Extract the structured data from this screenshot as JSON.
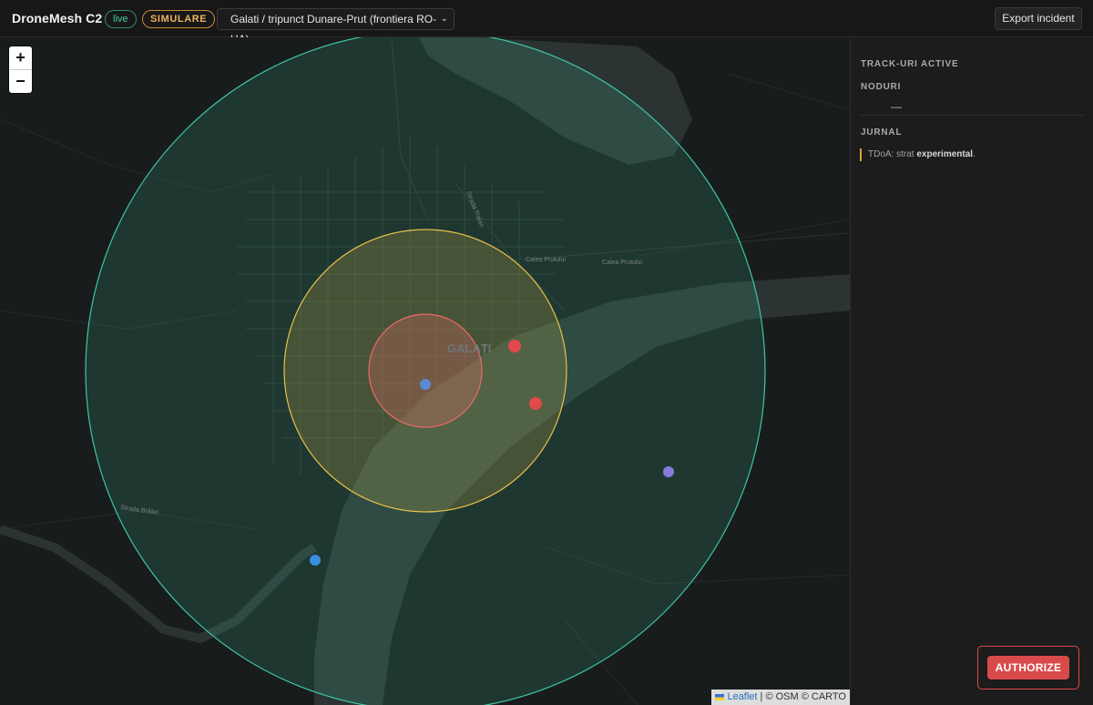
{
  "app": {
    "title": "DroneMesh C2",
    "live_badge": "live",
    "mode_badge": "SIMULARE"
  },
  "location_select": {
    "selected": "Galati / tripunct Dunare-Prut (frontiera RO-UA)"
  },
  "toolbar": {
    "export_label": "Export incident"
  },
  "map": {
    "zoom_in": "+",
    "zoom_out": "−",
    "city_label": "GALAȚI",
    "street_labels": [
      "Strada Traian",
      "Calea Prutului",
      "Calea Prutului",
      "Strada Brăilei"
    ],
    "attribution": {
      "leaflet": "Leaflet",
      "rest": " | © OSM © CARTO"
    },
    "zones": [
      {
        "name": "outer",
        "color": "#3fc7a0"
      },
      {
        "name": "middle",
        "color": "#e8c14a"
      },
      {
        "name": "inner",
        "color": "#ee6a6a"
      }
    ],
    "markers": [
      {
        "kind": "node",
        "color": "#5a8bd0"
      },
      {
        "kind": "track",
        "color": "#e04a4a"
      },
      {
        "kind": "track",
        "color": "#e04a4a"
      },
      {
        "kind": "track",
        "color": "#8a7ae0"
      },
      {
        "kind": "track",
        "color": "#3a8fe0"
      }
    ]
  },
  "sidebar": {
    "tracks_title": "TRACK-URI ACTIVE",
    "nodes_title": "NODURI",
    "nodes_empty": "—",
    "log_title": "JURNAL",
    "log_entry": {
      "prefix": "TDoA: strat ",
      "bold": "experimental",
      "suffix": "."
    },
    "authorize_label": "AUTHORIZE"
  }
}
